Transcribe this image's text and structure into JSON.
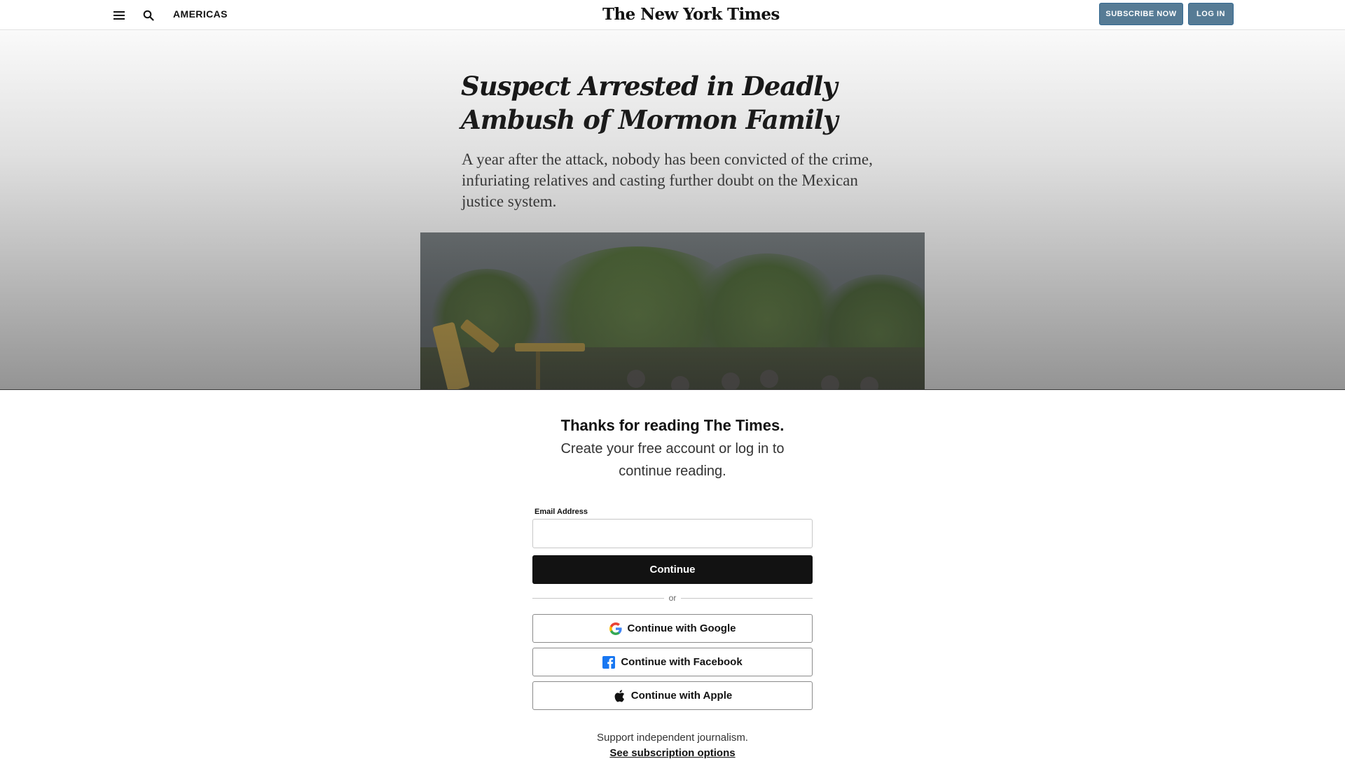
{
  "header": {
    "section_label": "AMERICAS",
    "logo_text": "The New York Times",
    "subscribe_label": "SUBSCRIBE NOW",
    "login_label": "LOG IN",
    "menu_icon": "hamburger-menu-icon",
    "search_icon": "search-icon"
  },
  "article": {
    "headline": "Suspect Arrested in Deadly Ambush of Mormon Family",
    "summary": "A year after the attack, nobody has been convicted of the crime, infuriating relatives and casting further doubt on the Mexican justice system."
  },
  "gateway": {
    "title": "Thanks for reading The Times.",
    "subtitle": "Create your free account or log in to continue reading.",
    "email_label": "Email Address",
    "email_value": "",
    "continue_label": "Continue",
    "divider_text": "or",
    "google_label": "Continue with Google",
    "facebook_label": "Continue with Facebook",
    "apple_label": "Continue with Apple",
    "support_text": "Support independent journalism.",
    "subscription_link": "See subscription options"
  },
  "colors": {
    "subscribe_bg": "#567b95",
    "continue_bg": "#121212",
    "facebook_blue": "#1877f2"
  }
}
